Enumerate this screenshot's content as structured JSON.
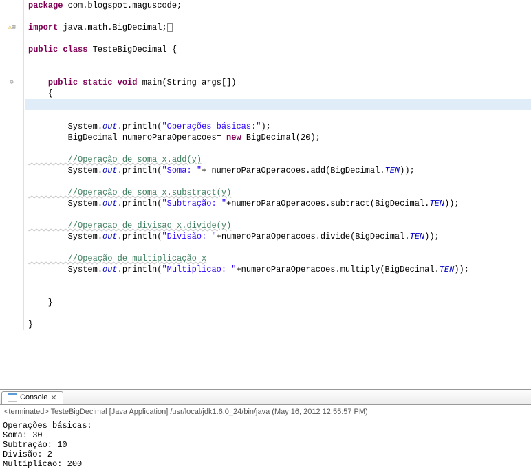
{
  "code": {
    "package_kw": "package",
    "package_name": " com.blogspot.maguscode;",
    "import_kw": "import",
    "import_name": " java.math.BigDecimal;",
    "public_kw": "public",
    "class_kw": "class",
    "class_name": " TesteBigDecimal {",
    "static_kw": "static",
    "void_kw": "void",
    "main_sig": " main(String args[])",
    "open_brace": "    {",
    "sys": "        System.",
    "out": "out",
    "println": ".println(",
    "str_ops": "\"Operações básicas:\"",
    "close_paren": ");",
    "bigdec_decl_pre": "        BigDecimal numeroParaOperacoes= ",
    "new_kw": "new",
    "bigdec_decl_post": " BigDecimal(20);",
    "cmt_soma": "        //Operação de soma x.add(y)",
    "str_soma": "\"Soma: \"",
    "add_call": "+ numeroParaOperacoes.add(BigDecimal.",
    "ten": "TEN",
    "close_call": "));",
    "cmt_sub": "        //Operação de soma x.substract(y)",
    "str_sub": "\"Subtração: \"",
    "sub_call": "+numeroParaOperacoes.subtract(BigDecimal.",
    "cmt_div": "        //Operacao de divisao x.divide(y)",
    "str_div": "\"Divisão: \"",
    "div_call": "+numeroParaOperacoes.divide(BigDecimal.",
    "cmt_mul": "        //Opeação de multiplicação x",
    "str_mul": "\"Multiplicao: \"",
    "mul_call": "+numeroParaOperacoes.multiply(BigDecimal.",
    "close_method": "    }",
    "close_class": "}"
  },
  "console": {
    "tab_label": "Console",
    "status": "<terminated> TesteBigDecimal [Java Application] /usr/local/jdk1.6.0_24/bin/java (May 16, 2012 12:55:57 PM)",
    "output": [
      "Operações básicas:",
      "Soma: 30",
      "Subtração: 10",
      "Divisão: 2",
      "Multiplicao: 200"
    ]
  }
}
